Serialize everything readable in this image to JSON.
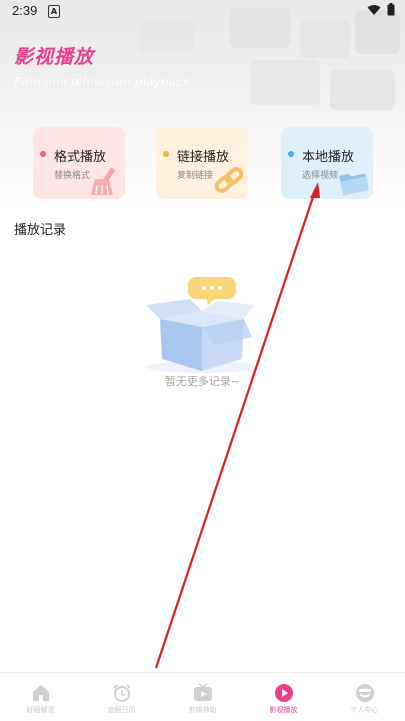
{
  "status_bar": {
    "time": "2:39",
    "a_icon": "A"
  },
  "header": {
    "title": "影视播放",
    "subtitle": "Film and television playback"
  },
  "cards": [
    {
      "title": "格式播放",
      "subtitle": "替换格式",
      "icon": "broom-icon",
      "dot_color": "#f06478",
      "bg": "#ffe5e6",
      "icon_color": "#f4a3a3"
    },
    {
      "title": "链接播放",
      "subtitle": "复制链接",
      "icon": "chain-link-icon",
      "dot_color": "#f5b83d",
      "bg": "#fff1dd",
      "icon_color": "#f6c06a"
    },
    {
      "title": "本地播放",
      "subtitle": "选择视频",
      "icon": "folder-icon",
      "dot_color": "#4aa8e8",
      "bg": "#dff0fd",
      "icon_color": "#8fc4ef"
    }
  ],
  "history": {
    "title": "播放记录",
    "empty_text": "暂无更多记录~"
  },
  "nav": {
    "items": [
      {
        "label": "好剧解说",
        "icon": "home-icon",
        "active": false
      },
      {
        "label": "追剧日历",
        "icon": "alarm-clock-icon",
        "active": false
      },
      {
        "label": "剪辑神助",
        "icon": "tv-icon",
        "active": false
      },
      {
        "label": "影视播放",
        "icon": "play-icon",
        "active": true
      },
      {
        "label": "个人中心",
        "icon": "profile-icon",
        "active": false
      }
    ]
  },
  "colors": {
    "accent": "#e8418c",
    "arrow": "#e02020"
  }
}
